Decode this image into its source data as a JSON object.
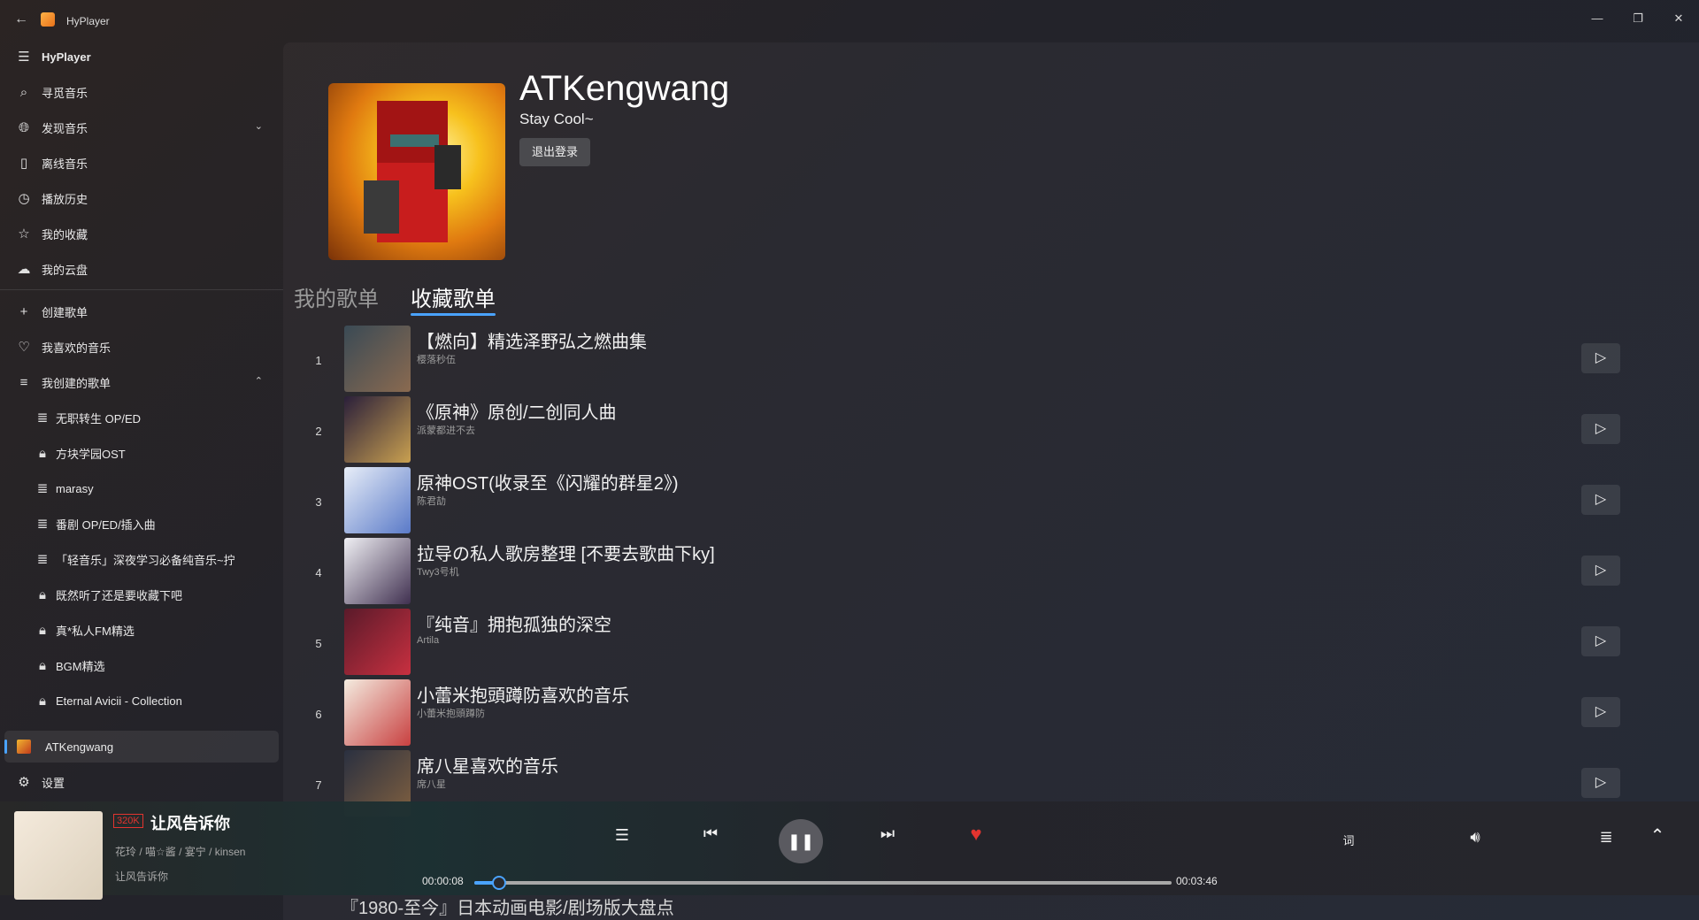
{
  "window": {
    "title": "HyPlayer",
    "controls": {
      "minimize": "—",
      "maximize": "❐",
      "close": "✕"
    }
  },
  "sidebar": {
    "header": "HyPlayer",
    "items": [
      {
        "label": "寻觅音乐",
        "icon": "search-icon"
      },
      {
        "label": "发现音乐",
        "icon": "globe-icon"
      },
      {
        "label": "离线音乐",
        "icon": "phone-icon"
      },
      {
        "label": "播放历史",
        "icon": "clock-icon"
      },
      {
        "label": "我的收藏",
        "icon": "star-icon"
      },
      {
        "label": "我的云盘",
        "icon": "cloud-icon"
      }
    ],
    "create_playlist": "创建歌单",
    "liked_music": "我喜欢的音乐",
    "my_playlists_header": "我创建的歌单",
    "playlists": [
      {
        "label": "无职转生 OP/ED",
        "icon": "playlist-icon"
      },
      {
        "label": "方块学园OST",
        "icon": "lock-icon"
      },
      {
        "label": "marasy",
        "icon": "playlist-icon"
      },
      {
        "label": "番剧 OP/ED/插入曲",
        "icon": "playlist-icon"
      },
      {
        "label": "「轻音乐」深夜学习必备纯音乐~拧",
        "icon": "playlist-icon"
      },
      {
        "label": "既然听了还是要收藏下吧",
        "icon": "lock-icon"
      },
      {
        "label": "真*私人FM精选",
        "icon": "lock-icon"
      },
      {
        "label": "BGM精选",
        "icon": "lock-icon"
      },
      {
        "label": "Eternal Avicii - Collection",
        "icon": "lock-icon"
      }
    ],
    "account": "ATKengwang",
    "settings": "设置"
  },
  "profile": {
    "username": "ATKengwang",
    "signature": "Stay Cool~",
    "logout_label": "退出登录"
  },
  "tabs": [
    {
      "label": "我的歌单",
      "active": false
    },
    {
      "label": "收藏歌单",
      "active": true
    }
  ],
  "playlists": [
    {
      "index": "1",
      "title": "【燃向】精选泽野弘之燃曲集",
      "creator": "樱落秒伍",
      "cover": [
        "#3a4a55",
        "#8a6a50"
      ]
    },
    {
      "index": "2",
      "title": "《原神》原创/二创同人曲",
      "creator": "派蒙都进不去",
      "cover": [
        "#2a1f3a",
        "#c9a050"
      ]
    },
    {
      "index": "3",
      "title": "原神OST(收录至《闪耀的群星2》)",
      "creator": "陈君劼",
      "cover": [
        "#e8eef8",
        "#5a7ac8"
      ]
    },
    {
      "index": "4",
      "title": "拉导の私人歌房整理 [不要去歌曲下ky]",
      "creator": "Twy3号机",
      "cover": [
        "#f0f0f4",
        "#403050"
      ]
    },
    {
      "index": "5",
      "title": "『纯音』拥抱孤独的深空",
      "creator": "Artila",
      "cover": [
        "#5a1a2a",
        "#c83040"
      ]
    },
    {
      "index": "6",
      "title": "小蕾米抱頭蹲防喜欢的音乐",
      "creator": "小蕾米抱頭蹲防",
      "cover": [
        "#f4ece0",
        "#c84040"
      ]
    },
    {
      "index": "7",
      "title": "席八星喜欢的音乐",
      "creator": "席八星",
      "cover": [
        "#2a3040",
        "#806040"
      ]
    }
  ],
  "peek_row_title": "『1980-至今』日本动画电影/剧场版大盘点",
  "player": {
    "quality": "320K",
    "title": "让风告诉你",
    "artist": "花玲 / 喵☆酱 / 宴宁 / kinsen",
    "album": "让风告诉你",
    "current_time": "00:00:08",
    "total_time": "00:03:46",
    "progress": 0.035,
    "lyrics_label": "词",
    "icons": {
      "queue": "playlist-icon",
      "prev": "previous-icon",
      "pause": "pause-icon",
      "next": "next-icon",
      "like": "heart-icon",
      "volume": "volume-icon",
      "list": "list-icon",
      "expand": "chevron-up-icon"
    }
  },
  "colors": {
    "accent": "#4aa3ff",
    "like": "#e3342f"
  }
}
